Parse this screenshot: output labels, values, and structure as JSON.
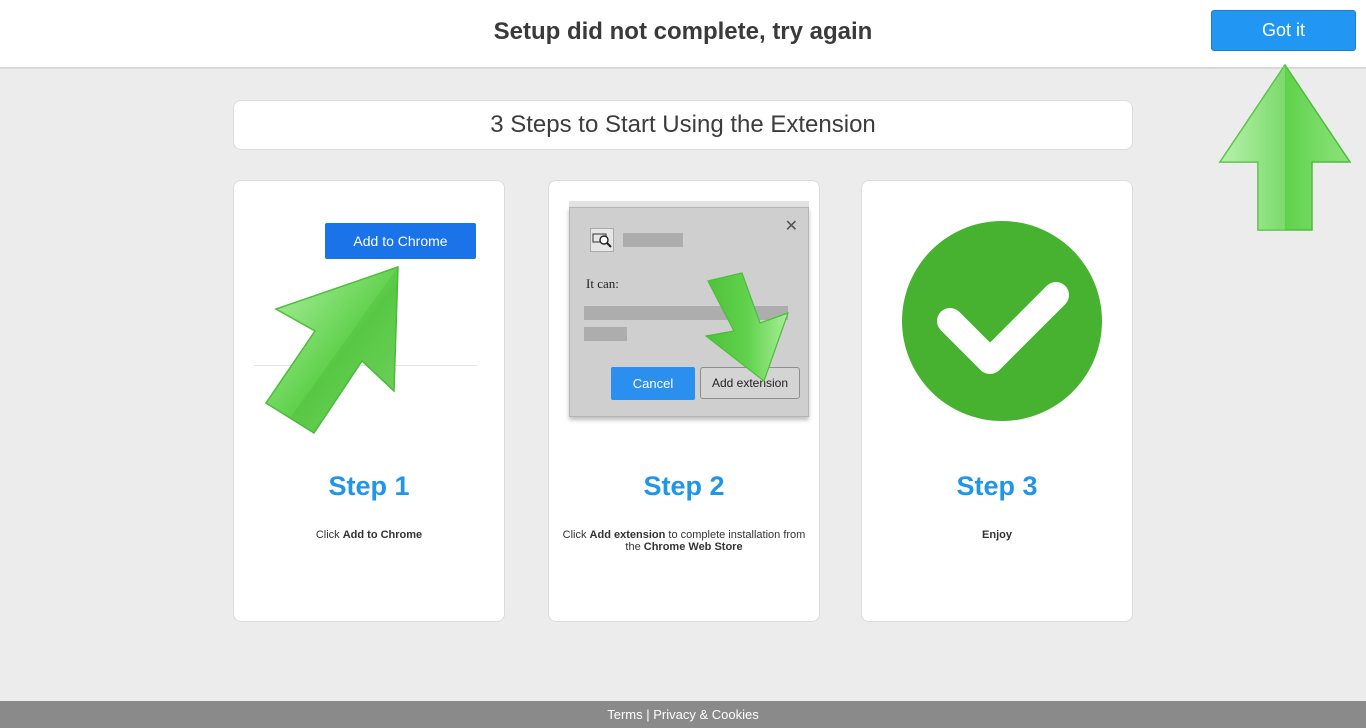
{
  "header": {
    "title": "Setup did not complete, try again",
    "got_it_label": "Got it"
  },
  "heading": "3 Steps to Start Using the Extension",
  "steps": [
    {
      "title": "Step 1",
      "desc_prefix": "Click ",
      "desc_bold": "Add to Chrome",
      "button_label": "Add to Chrome"
    },
    {
      "title": "Step 2",
      "desc_prefix": "Click ",
      "desc_bold": "Add extension",
      "desc_mid": " to complete installation from the ",
      "desc_bold2": "Chrome Web Store",
      "dialog": {
        "close": "✕",
        "it_can": "It can:",
        "cancel_label": "Cancel",
        "add_label": "Add extension"
      }
    },
    {
      "title": "Step 3",
      "desc_bold": "Enjoy"
    }
  ],
  "footer": {
    "terms": "Terms",
    "separator": " | ",
    "privacy": "Privacy & Cookies"
  },
  "colors": {
    "accent": "#2196f3",
    "step_title": "#2196e8",
    "arrow_green": "#5ed04a",
    "check_green": "#46b22f"
  },
  "icons": [
    "arrow-up-icon",
    "arrow-diagonal-icon",
    "arrow-down-icon",
    "checkmark-icon",
    "magnifier-icon",
    "close-icon"
  ]
}
